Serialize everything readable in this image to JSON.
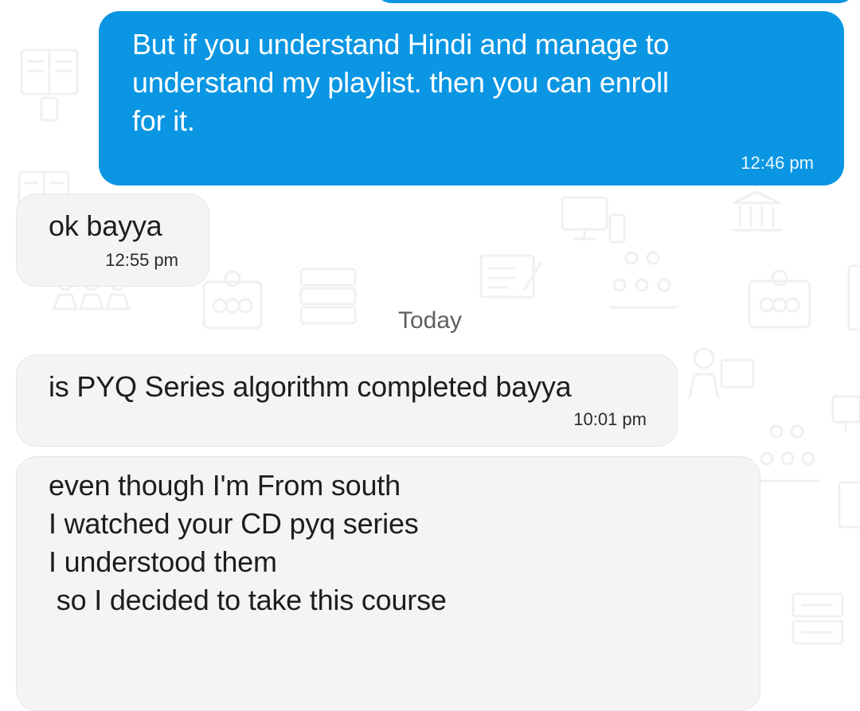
{
  "date_divider": "Today",
  "messages": [
    {
      "direction": "outgoing",
      "text": "But if you understand Hindi and manage to\nunderstand my playlist. then you can enroll\nfor it.",
      "time": "12:46 pm"
    },
    {
      "direction": "incoming",
      "text": "ok bayya",
      "time": "12:55 pm"
    },
    {
      "direction": "incoming",
      "text": "is PYQ Series algorithm completed bayya",
      "time": "10:01 pm"
    },
    {
      "direction": "incoming",
      "text": "even though I'm From south\nI watched your CD pyq series\nI understood them\n so I decided to take this course",
      "time": ""
    }
  ],
  "colors": {
    "outgoing_bubble": "#0a96e3",
    "incoming_bubble": "#f4f4f4",
    "background": "#ffffff"
  },
  "background_icons": [
    "book-icon",
    "exam-icon",
    "bank-icon",
    "computer-icon",
    "people-icon",
    "clock-icon",
    "server-icon",
    "teacher-icon"
  ]
}
